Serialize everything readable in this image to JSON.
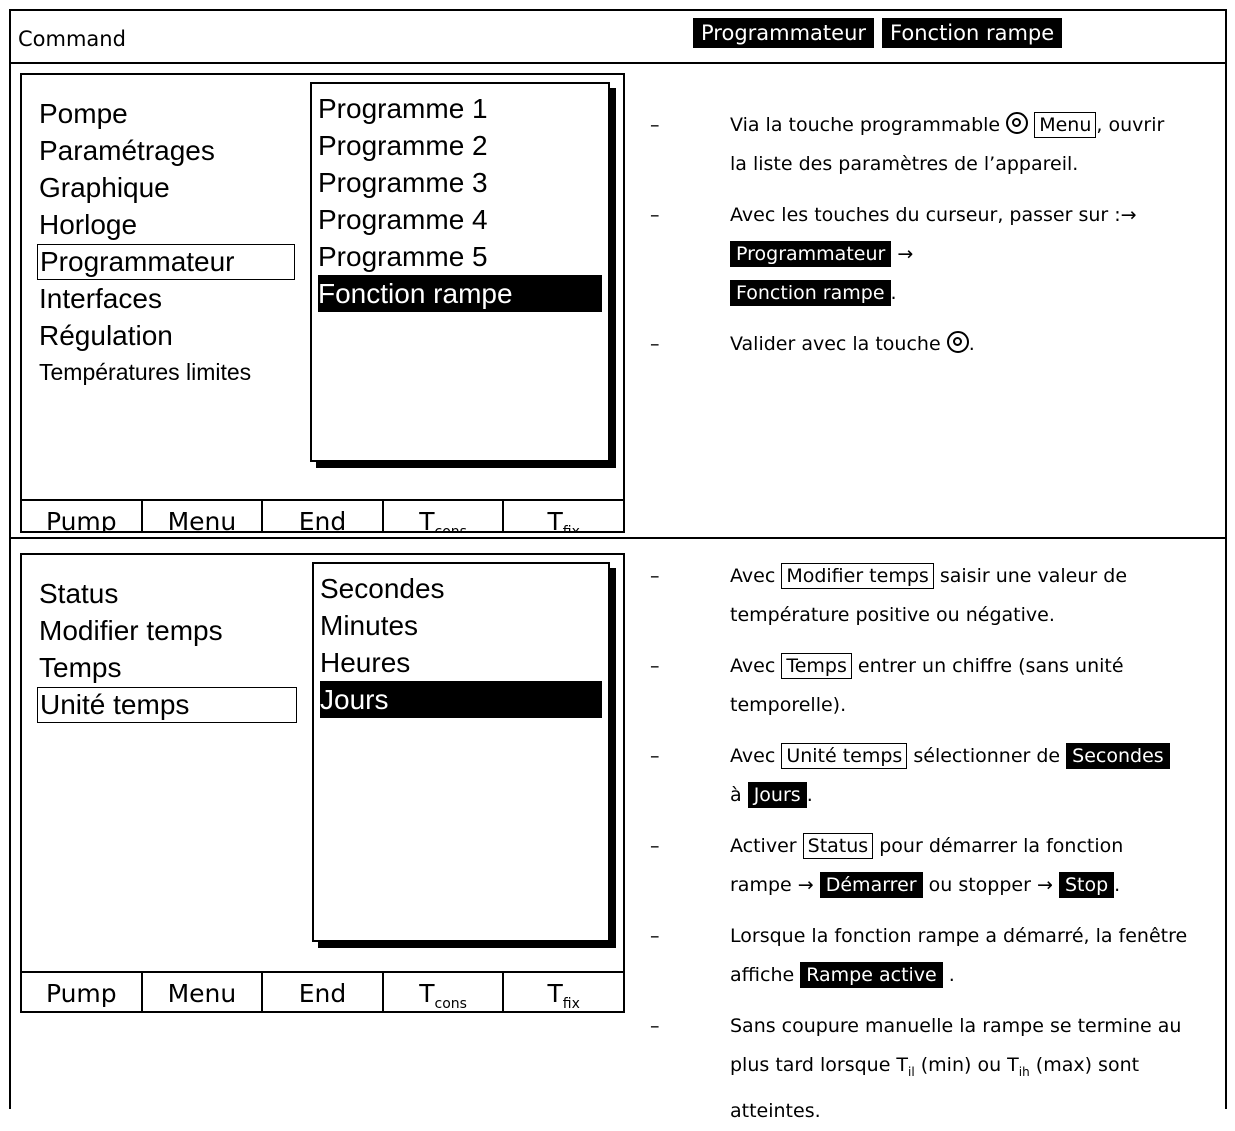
{
  "header": {
    "left": "Command",
    "tags": [
      "Programmateur",
      "Fonction rampe"
    ]
  },
  "screen1": {
    "menu_items": [
      "Pompe",
      "Paramétrages",
      "Graphique",
      "Horloge",
      "Programmateur",
      "Interfaces",
      "Régulation",
      "Températures limites"
    ],
    "selected_index": 4,
    "submenu": [
      "Programme 1",
      "Programme 2",
      "Programme 3",
      "Programme 4",
      "Programme 5",
      "Fonction rampe"
    ],
    "submenu_highlight_index": 5,
    "softkeys": [
      "Pump",
      "Menu",
      "End",
      "T",
      "T"
    ],
    "softkey_subs": [
      "cons",
      "fix"
    ]
  },
  "screen2": {
    "menu_items": [
      "Status",
      "Modifier temps",
      "Temps",
      "Unité temps"
    ],
    "selected_index": 3,
    "submenu": [
      "Secondes",
      "Minutes",
      "Heures",
      "Jours"
    ],
    "submenu_highlight_index": 3,
    "softkeys": [
      "Pump",
      "Menu",
      "End",
      "T",
      "T"
    ],
    "softkey_subs": [
      "cons",
      "fix"
    ]
  },
  "steps1": {
    "dash": "–",
    "s1": {
      "a": "Via la touche programmable",
      "key": "Menu",
      "b": ", ouvrir",
      "c": "la liste des paramètres de l’appareil."
    },
    "s2": {
      "a": "Avec les touches du curseur, passer sur :→",
      "k1": "Programmateur",
      "arrow": "→",
      "k2": "Fonction rampe",
      "end": "."
    },
    "s3": {
      "a": "Valider avec la touche",
      "end": "."
    }
  },
  "steps2": {
    "s1": {
      "a": "Avec",
      "key": "Modifier temps",
      "b": "saisir une valeur de",
      "c": "température positive ou négative."
    },
    "s2": {
      "a": "Avec",
      "key": "Temps",
      "b": "entrer un chiffre (sans unité",
      "c": "temporelle)."
    },
    "s3": {
      "a": "Avec",
      "key": "Unité temps",
      "b": "sélectionner de",
      "k2": "Secondes",
      "c": "à",
      "k3": "Jours",
      "end": "."
    },
    "s4": {
      "a": "Activer",
      "key": "Status",
      "b": "pour démarrer la fonction",
      "c": "rampe →",
      "k2": "Démarrer",
      "d": "ou stopper →",
      "k3": "Stop",
      "end": "."
    },
    "s5": {
      "a": "Lorsque la fonction rampe a démarré, la fenêtre",
      "b": "affiche",
      "k": "Rampe active",
      "end": "."
    },
    "s6": {
      "a": "Sans coupure manuelle la rampe se termine au",
      "b": "plus tard lorsque T",
      "sub1": "il",
      "c": "(min) ou T",
      "sub2": "ih",
      "d": "(max) sont",
      "e": "atteintes."
    }
  }
}
